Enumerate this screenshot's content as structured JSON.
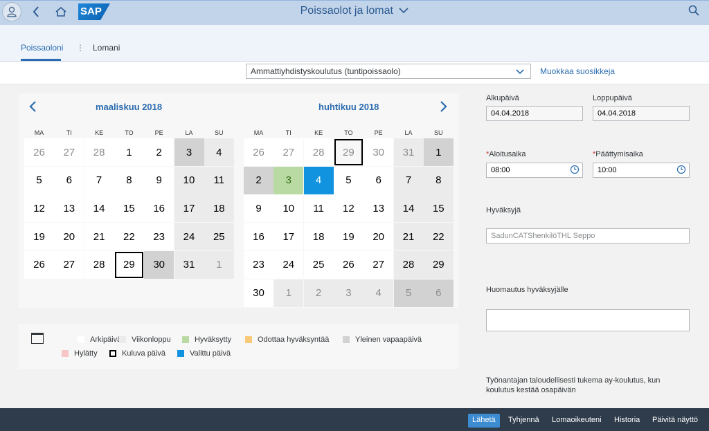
{
  "shell": {
    "logo_text": "SAP",
    "title": "Poissaolot ja lomat"
  },
  "tabs": [
    {
      "label": "Poissaoloni",
      "active": true
    },
    {
      "label": "Lomani",
      "active": false
    }
  ],
  "toolbar": {
    "absence_type": "Ammattiyhdistyskoulutus (tuntipoissaolo)",
    "favorites_link": "Muokkaa suosikkeja"
  },
  "calendar": {
    "weekdays": [
      "MA",
      "TI",
      "KE",
      "TO",
      "PE",
      "LA",
      "SU"
    ],
    "months": [
      {
        "title": "maaliskuu 2018",
        "rows": [
          [
            {
              "d": "26",
              "t": "other"
            },
            {
              "d": "27",
              "t": "other"
            },
            {
              "d": "28",
              "t": "other"
            },
            {
              "d": "1",
              "t": "work"
            },
            {
              "d": "2",
              "t": "work"
            },
            {
              "d": "3",
              "t": "holiday"
            },
            {
              "d": "4",
              "t": "weekend"
            }
          ],
          [
            {
              "d": "5",
              "t": "work"
            },
            {
              "d": "6",
              "t": "work"
            },
            {
              "d": "7",
              "t": "work"
            },
            {
              "d": "8",
              "t": "work"
            },
            {
              "d": "9",
              "t": "work"
            },
            {
              "d": "10",
              "t": "weekend"
            },
            {
              "d": "11",
              "t": "weekend"
            }
          ],
          [
            {
              "d": "12",
              "t": "work"
            },
            {
              "d": "13",
              "t": "work"
            },
            {
              "d": "14",
              "t": "work"
            },
            {
              "d": "15",
              "t": "work"
            },
            {
              "d": "16",
              "t": "work"
            },
            {
              "d": "17",
              "t": "weekend"
            },
            {
              "d": "18",
              "t": "weekend"
            }
          ],
          [
            {
              "d": "19",
              "t": "work"
            },
            {
              "d": "20",
              "t": "work"
            },
            {
              "d": "21",
              "t": "work"
            },
            {
              "d": "22",
              "t": "work"
            },
            {
              "d": "23",
              "t": "work"
            },
            {
              "d": "24",
              "t": "weekend"
            },
            {
              "d": "25",
              "t": "weekend"
            }
          ],
          [
            {
              "d": "26",
              "t": "work"
            },
            {
              "d": "27",
              "t": "work"
            },
            {
              "d": "28",
              "t": "work"
            },
            {
              "d": "29",
              "t": "today"
            },
            {
              "d": "30",
              "t": "holiday"
            },
            {
              "d": "31",
              "t": "weekend"
            },
            {
              "d": "1",
              "t": "other-weekend"
            }
          ]
        ]
      },
      {
        "title": "huhtikuu 2018",
        "rows": [
          [
            {
              "d": "26",
              "t": "other"
            },
            {
              "d": "27",
              "t": "other"
            },
            {
              "d": "28",
              "t": "other"
            },
            {
              "d": "29",
              "t": "other-today"
            },
            {
              "d": "30",
              "t": "other"
            },
            {
              "d": "31",
              "t": "other-weekend"
            },
            {
              "d": "1",
              "t": "holiday"
            }
          ],
          [
            {
              "d": "2",
              "t": "holiday"
            },
            {
              "d": "3",
              "t": "approved"
            },
            {
              "d": "4",
              "t": "selected"
            },
            {
              "d": "5",
              "t": "work"
            },
            {
              "d": "6",
              "t": "work"
            },
            {
              "d": "7",
              "t": "weekend"
            },
            {
              "d": "8",
              "t": "weekend"
            }
          ],
          [
            {
              "d": "9",
              "t": "work"
            },
            {
              "d": "10",
              "t": "work"
            },
            {
              "d": "11",
              "t": "work"
            },
            {
              "d": "12",
              "t": "work"
            },
            {
              "d": "13",
              "t": "work"
            },
            {
              "d": "14",
              "t": "weekend"
            },
            {
              "d": "15",
              "t": "weekend"
            }
          ],
          [
            {
              "d": "16",
              "t": "work"
            },
            {
              "d": "17",
              "t": "work"
            },
            {
              "d": "18",
              "t": "work"
            },
            {
              "d": "19",
              "t": "work"
            },
            {
              "d": "20",
              "t": "work"
            },
            {
              "d": "21",
              "t": "weekend"
            },
            {
              "d": "22",
              "t": "weekend"
            }
          ],
          [
            {
              "d": "23",
              "t": "work"
            },
            {
              "d": "24",
              "t": "work"
            },
            {
              "d": "25",
              "t": "work"
            },
            {
              "d": "26",
              "t": "work"
            },
            {
              "d": "27",
              "t": "work"
            },
            {
              "d": "28",
              "t": "weekend"
            },
            {
              "d": "29",
              "t": "weekend"
            }
          ],
          [
            {
              "d": "30",
              "t": "work"
            },
            {
              "d": "1",
              "t": "other-weekend"
            },
            {
              "d": "2",
              "t": "other-weekend"
            },
            {
              "d": "3",
              "t": "other-weekend"
            },
            {
              "d": "4",
              "t": "other-weekend"
            },
            {
              "d": "5",
              "t": "other-holiday"
            },
            {
              "d": "6",
              "t": "other-holiday"
            }
          ]
        ]
      }
    ]
  },
  "legend": {
    "items": [
      {
        "label": "Arkipäivä",
        "color": "#ffffff"
      },
      {
        "label": "Viikonloppu",
        "color": "#ebebeb"
      },
      {
        "label": "Hyväksytty",
        "color": "#b9dba3"
      },
      {
        "label": "Odottaa hyväksyntää",
        "color": "#f9c97a"
      },
      {
        "label": "Yleinen vapaapäivä",
        "color": "#d2d2d2"
      },
      {
        "label": "Hylätty",
        "color": "#f6c5c5"
      },
      {
        "label": "Kuluva päivä",
        "color": "outline"
      },
      {
        "label": "Valittu päivä",
        "color": "#1193e0"
      }
    ]
  },
  "form": {
    "start_date_label": "Alkupäivä",
    "start_date": "04.04.2018",
    "end_date_label": "Loppupäivä",
    "end_date": "04.04.2018",
    "start_time_label": "Aloitusaika",
    "start_time": "08:00",
    "end_time_label": "Päättymisaika",
    "end_time": "10:00",
    "approver_label": "Hyväksyjä",
    "approver": "SadunCATShenkilöTHL Seppo",
    "note_label": "Huomautus hyväksyjälle",
    "note_value": "",
    "info_text": "Työnantajan taloudellisesti tukema ay-koulutus, kun koulutus kestää osapäivän"
  },
  "footer": {
    "buttons": [
      "Lähetä",
      "Tyhjennä",
      "Lomaoikeuteni",
      "Historia",
      "Päivitä näyttö"
    ]
  }
}
